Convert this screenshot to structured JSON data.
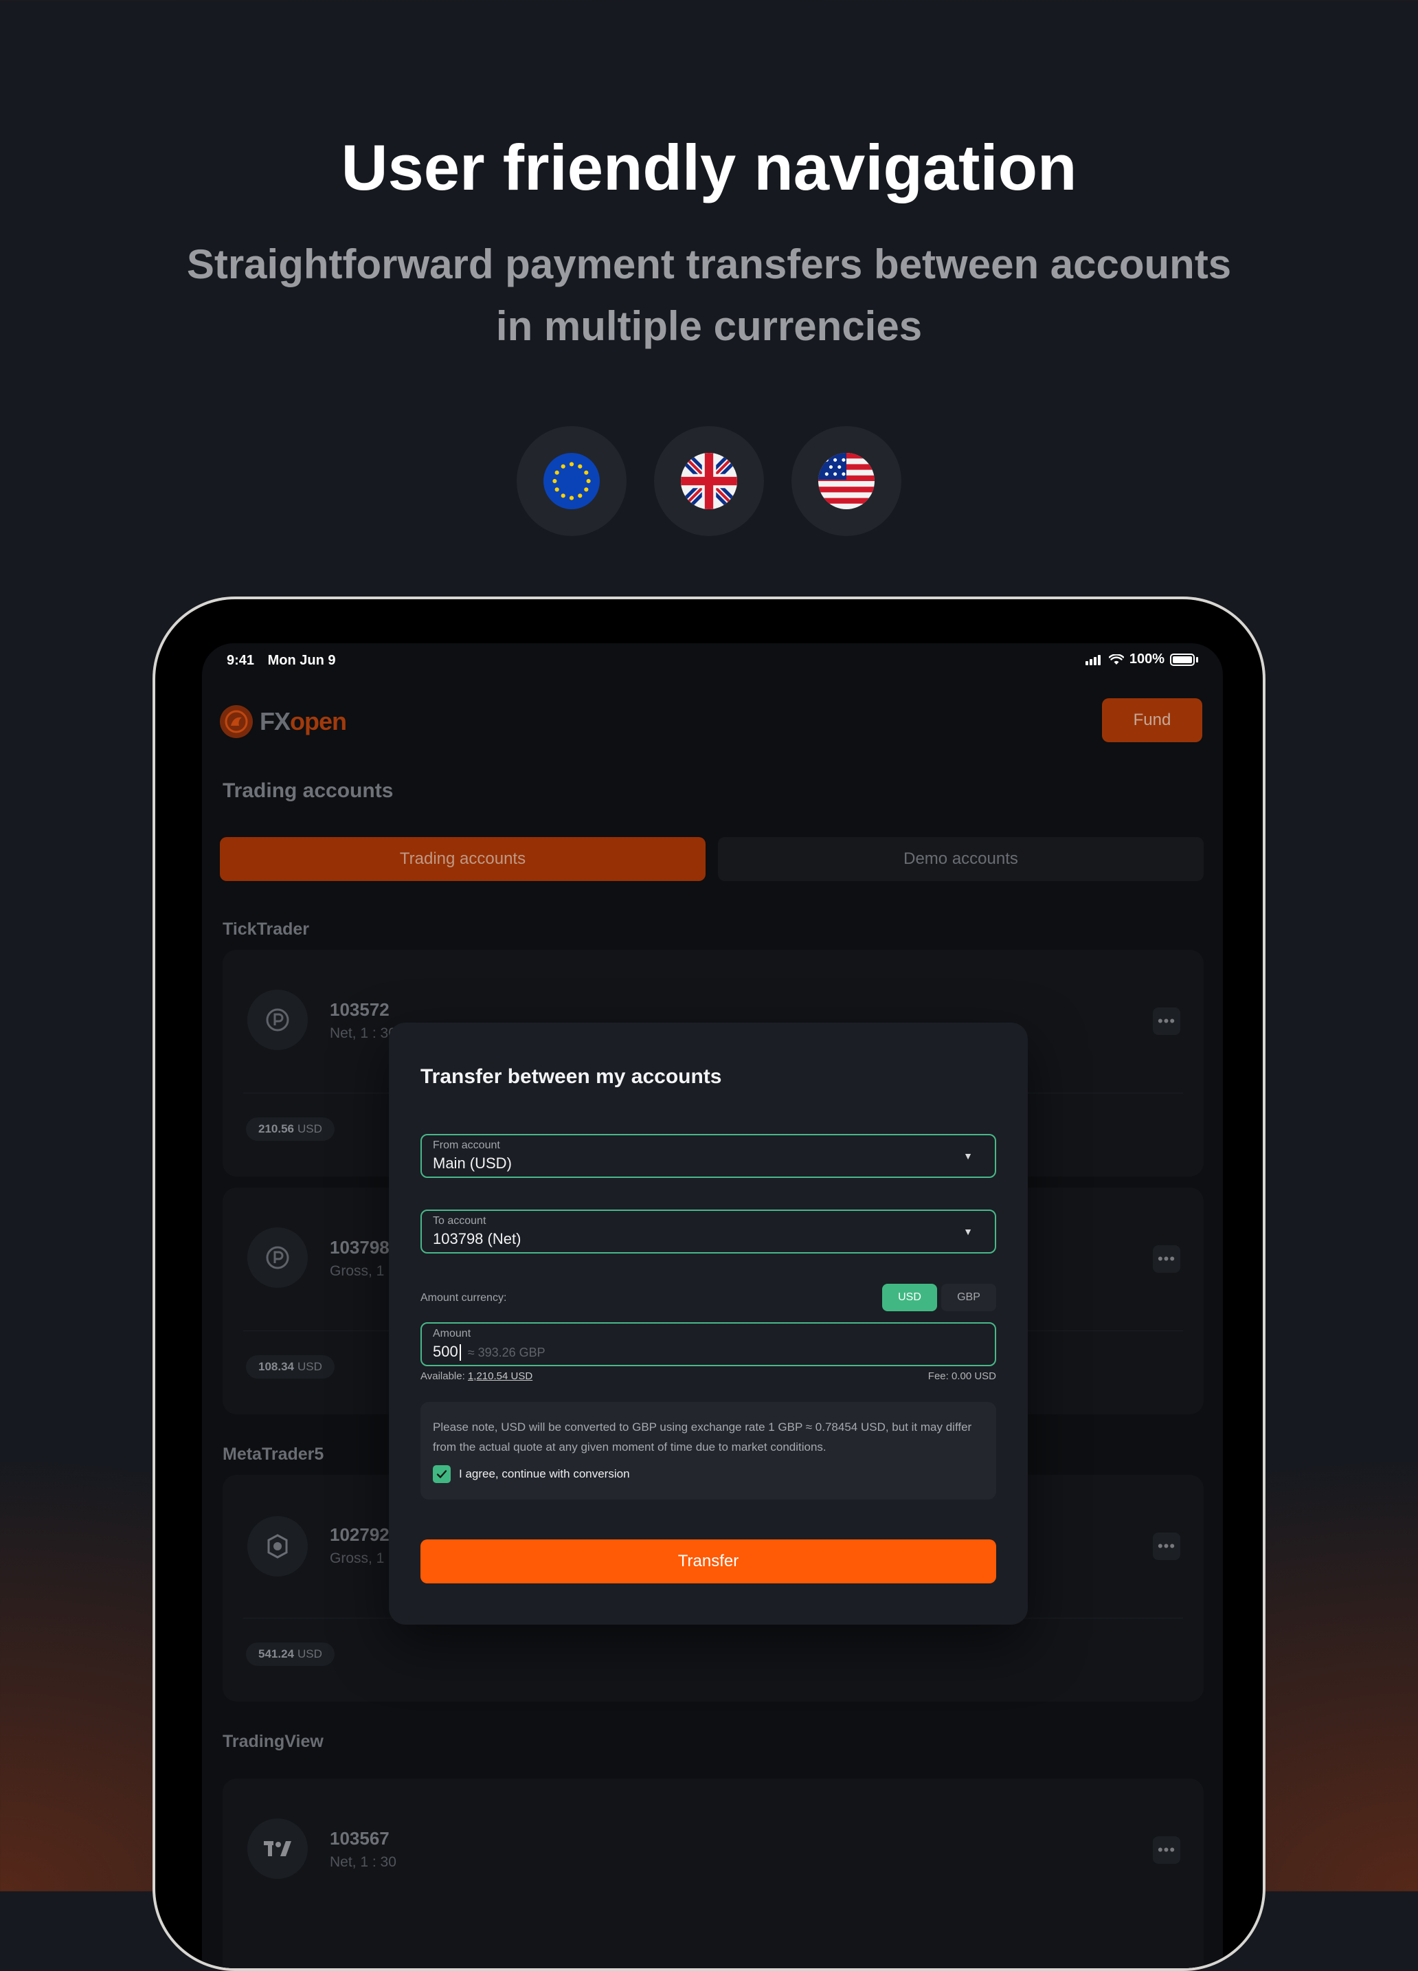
{
  "hero": {
    "title": "User friendly navigation",
    "subtitle_line1": "Straightforward payment transfers between accounts",
    "subtitle_line2": "in multiple currencies"
  },
  "flags": [
    {
      "name": "eu-flag-icon"
    },
    {
      "name": "uk-flag-icon"
    },
    {
      "name": "us-flag-icon"
    }
  ],
  "status_bar": {
    "time": "9:41",
    "date": "Mon Jun 9",
    "battery": "100%"
  },
  "header": {
    "logo_fx": "FX",
    "logo_open": "open",
    "fund_label": "Fund"
  },
  "page_title": "Trading accounts",
  "tabs": [
    {
      "label": "Trading accounts",
      "active": true
    },
    {
      "label": "Demo accounts",
      "active": false
    }
  ],
  "sections": [
    {
      "label": "TickTrader",
      "accounts": [
        {
          "number": "103572",
          "meta": "Net, 1 : 30",
          "balance": "210.56",
          "currency": "USD"
        },
        {
          "number": "103798",
          "meta": "Gross, 1 : 30",
          "balance": "108.34",
          "currency": "USD"
        }
      ]
    },
    {
      "label": "MetaTrader5",
      "accounts": [
        {
          "number": "102792",
          "meta": "Gross, 1 : 30",
          "balance": "541.24",
          "currency": "USD"
        }
      ]
    },
    {
      "label": "TradingView",
      "accounts": [
        {
          "number": "103567",
          "meta": "Net, 1 : 30"
        }
      ]
    }
  ],
  "modal": {
    "title": "Transfer between my accounts",
    "from": {
      "label": "From account",
      "value": "Main (USD)"
    },
    "to": {
      "label": "To account",
      "value": "103798 (Net)"
    },
    "currency_label": "Amount currency:",
    "currency_options": [
      "USD",
      "GBP"
    ],
    "currency_selected": "USD",
    "amount": {
      "label": "Amount",
      "value": "500",
      "approx": "≈ 393.26 GBP"
    },
    "available_label": "Available:",
    "available_value": "1,210.54 USD",
    "fee": "Fee: 0.00 USD",
    "note": "Please note, USD will be converted to GBP using exchange rate 1 GBP ≈ 0.78454 USD, but it may differ from the actual quote at any given moment of time due to market conditions.",
    "agree_label": "I agree, continue with conversion",
    "agree_checked": true,
    "transfer_label": "Transfer"
  },
  "colors": {
    "accent": "#ff5a05",
    "success": "#41b883"
  }
}
